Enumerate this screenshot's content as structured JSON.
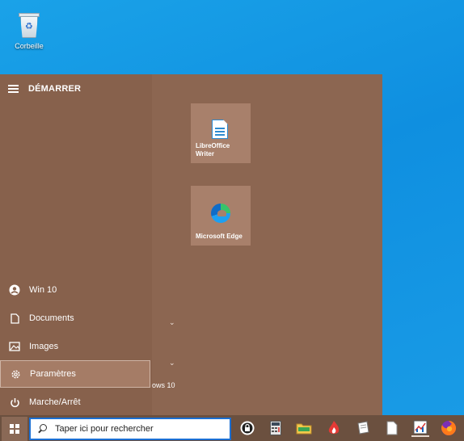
{
  "desktop": {
    "recycle_bin_label": "Corbeille"
  },
  "start_menu": {
    "header_title": "DÉMARRER",
    "left_items": [
      {
        "label": "Win 10",
        "icon": "user-icon"
      },
      {
        "label": "Documents",
        "icon": "document-icon"
      },
      {
        "label": "Images",
        "icon": "image-icon"
      },
      {
        "label": "Paramètres",
        "icon": "gear-icon"
      },
      {
        "label": "Marche/Arrêt",
        "icon": "power-icon"
      }
    ],
    "partial_text": "ows 10",
    "tiles": [
      {
        "label": "LibreOffice Writer",
        "icon": "libreoffice-writer-icon"
      },
      {
        "label": "Microsoft Edge",
        "icon": "edge-icon"
      }
    ]
  },
  "taskbar": {
    "search_placeholder": "Taper ici pour rechercher",
    "pinned": [
      "lock-icon",
      "calculator-icon",
      "folder-icon",
      "flame-app-icon",
      "notepad-icon",
      "document-icon",
      "charts-app-icon",
      "firefox-icon"
    ]
  }
}
